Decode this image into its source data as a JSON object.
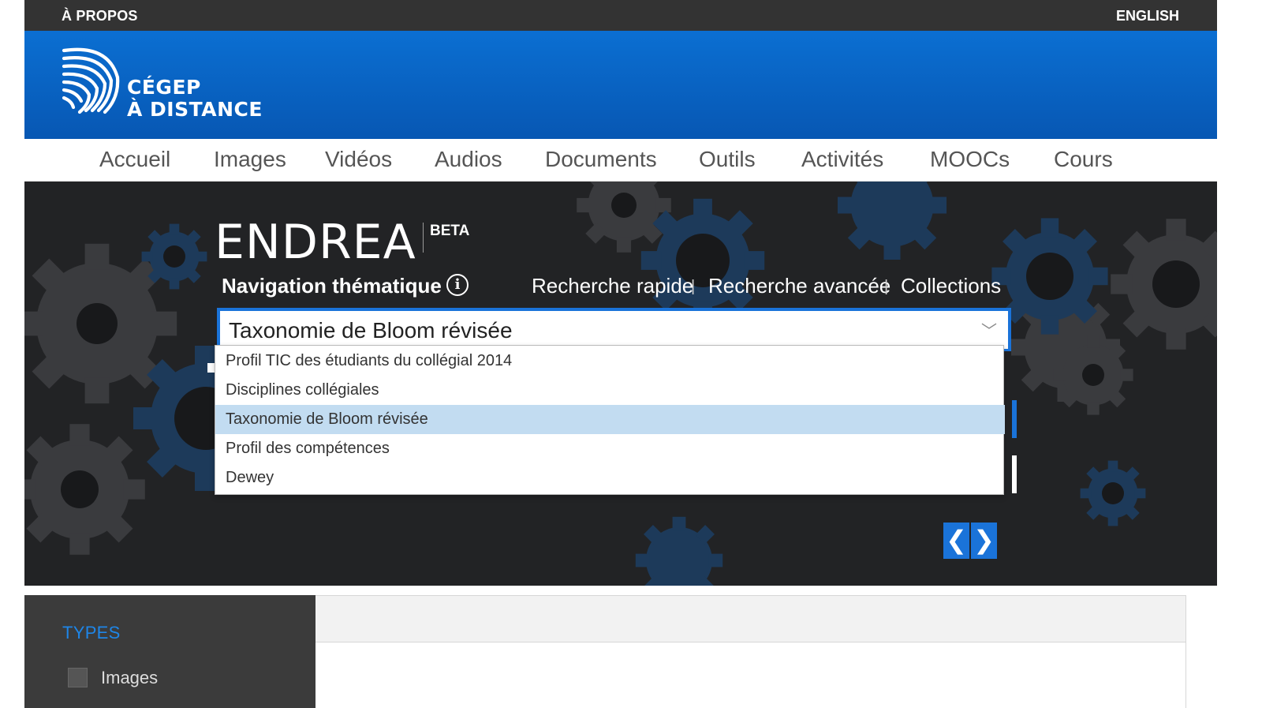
{
  "topbar": {
    "about": "À PROPOS",
    "language": "ENGLISH"
  },
  "brand": {
    "line1": "CÉGEP",
    "line2": "À DISTANCE"
  },
  "nav": {
    "items": [
      "Accueil",
      "Images",
      "Vidéos",
      "Audios",
      "Documents",
      "Outils",
      "Activités",
      "MOOCs",
      "Cours"
    ]
  },
  "hero": {
    "title": "ENDREA",
    "badge": "BETA",
    "section_title": "Navigation thématique",
    "info_icon": "info-icon",
    "links": [
      "Recherche rapide",
      "Recherche avancée",
      "Collections"
    ],
    "separator": "|"
  },
  "taxonomy_select": {
    "value": "Taxonomie de Bloom révisée",
    "options": [
      "Profil TIC des étudiants du collégial 2014",
      "Disciplines collégiales",
      "Taxonomie de Bloom révisée",
      "Profil des compétences",
      "Dewey"
    ],
    "selected_index": 2
  },
  "carousel": {
    "prev": "❮",
    "next": "❯"
  },
  "filters": {
    "heading": "TYPES",
    "options": [
      "Images"
    ]
  },
  "colors": {
    "accent": "#1a73d9",
    "header_blue": "#0a66c8",
    "dark": "#333333",
    "selected_option": "#c2dcf1"
  }
}
